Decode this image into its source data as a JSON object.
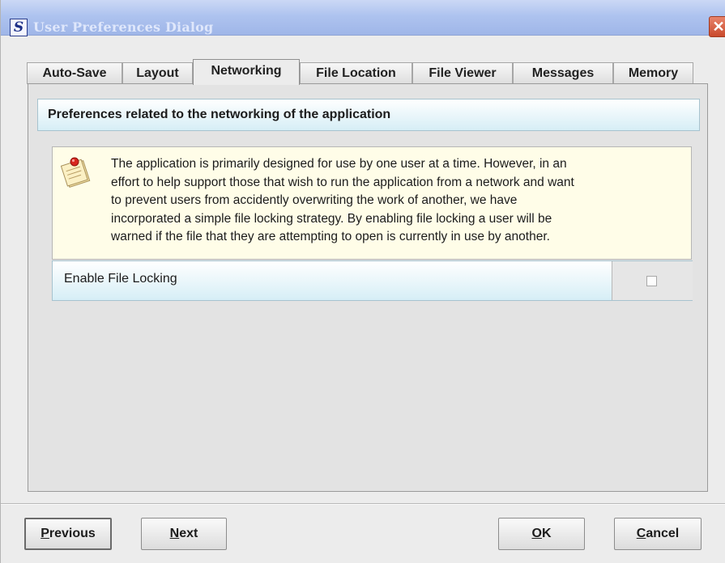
{
  "window": {
    "title": "User Preferences Dialog",
    "app_icon_letter": "S",
    "close_glyph": "✕"
  },
  "tabs": [
    {
      "label": "Auto-Save",
      "active": false
    },
    {
      "label": "Layout",
      "active": false
    },
    {
      "label": "Networking",
      "active": true
    },
    {
      "label": "File Location",
      "active": false
    },
    {
      "label": "File Viewer",
      "active": false
    },
    {
      "label": "Messages",
      "active": false
    },
    {
      "label": "Memory",
      "active": false
    }
  ],
  "panel": {
    "header": "Preferences related to the networking of the application",
    "info_icon": "notes-icon",
    "info_lines": [
      "The application is primarily designed for use by one user at a time. However, in an",
      "effort to help support those that wish to run the application from a network and want",
      "to prevent users from accidently overwriting the work of another, we have",
      "incorporated a simple file locking strategy. By enabling file locking a user will be",
      "warned if the file that they are attempting to open is currently in use by another."
    ],
    "option": {
      "label": "Enable File Locking",
      "checked": false
    }
  },
  "buttons": {
    "previous": {
      "mnemonic": "P",
      "rest": "revious"
    },
    "next": {
      "mnemonic": "N",
      "rest": "ext"
    },
    "ok": {
      "mnemonic": "O",
      "rest": "K"
    },
    "cancel": {
      "mnemonic": "C",
      "rest": "ancel"
    }
  },
  "colors": {
    "titlebar": "#aec3ef",
    "header_gradient_end": "#d6eef6",
    "info_background": "#fffde8"
  }
}
